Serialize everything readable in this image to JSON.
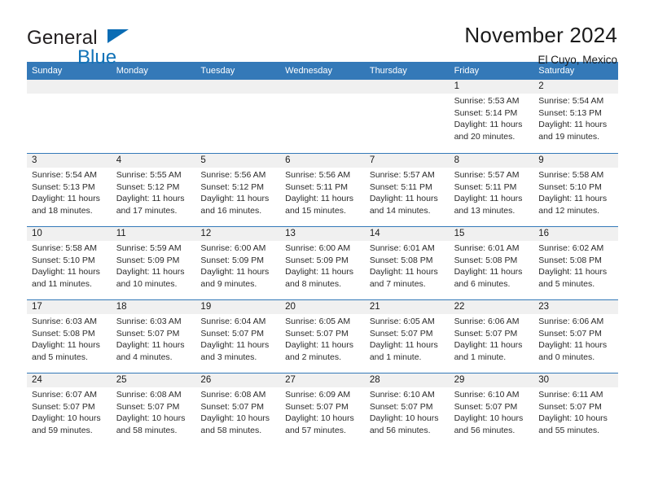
{
  "brand": {
    "name_part1": "General",
    "name_part2": "Blue",
    "logo_icon": "triangle-flag-icon"
  },
  "header": {
    "title": "November 2024",
    "subtitle": "El Cuyo, Mexico"
  },
  "colors": {
    "header_blue": "#3479b8",
    "day_band_gray": "#f0f0f0",
    "brand_blue": "#1273b8",
    "text": "#1a1a1a"
  },
  "weekdays": [
    "Sunday",
    "Monday",
    "Tuesday",
    "Wednesday",
    "Thursday",
    "Friday",
    "Saturday"
  ],
  "weeks": [
    [
      {
        "day": "",
        "empty": true
      },
      {
        "day": "",
        "empty": true
      },
      {
        "day": "",
        "empty": true
      },
      {
        "day": "",
        "empty": true
      },
      {
        "day": "",
        "empty": true
      },
      {
        "day": "1",
        "sunrise": "Sunrise: 5:53 AM",
        "sunset": "Sunset: 5:14 PM",
        "daylight": "Daylight: 11 hours and 20 minutes."
      },
      {
        "day": "2",
        "sunrise": "Sunrise: 5:54 AM",
        "sunset": "Sunset: 5:13 PM",
        "daylight": "Daylight: 11 hours and 19 minutes."
      }
    ],
    [
      {
        "day": "3",
        "sunrise": "Sunrise: 5:54 AM",
        "sunset": "Sunset: 5:13 PM",
        "daylight": "Daylight: 11 hours and 18 minutes."
      },
      {
        "day": "4",
        "sunrise": "Sunrise: 5:55 AM",
        "sunset": "Sunset: 5:12 PM",
        "daylight": "Daylight: 11 hours and 17 minutes."
      },
      {
        "day": "5",
        "sunrise": "Sunrise: 5:56 AM",
        "sunset": "Sunset: 5:12 PM",
        "daylight": "Daylight: 11 hours and 16 minutes."
      },
      {
        "day": "6",
        "sunrise": "Sunrise: 5:56 AM",
        "sunset": "Sunset: 5:11 PM",
        "daylight": "Daylight: 11 hours and 15 minutes."
      },
      {
        "day": "7",
        "sunrise": "Sunrise: 5:57 AM",
        "sunset": "Sunset: 5:11 PM",
        "daylight": "Daylight: 11 hours and 14 minutes."
      },
      {
        "day": "8",
        "sunrise": "Sunrise: 5:57 AM",
        "sunset": "Sunset: 5:11 PM",
        "daylight": "Daylight: 11 hours and 13 minutes."
      },
      {
        "day": "9",
        "sunrise": "Sunrise: 5:58 AM",
        "sunset": "Sunset: 5:10 PM",
        "daylight": "Daylight: 11 hours and 12 minutes."
      }
    ],
    [
      {
        "day": "10",
        "sunrise": "Sunrise: 5:58 AM",
        "sunset": "Sunset: 5:10 PM",
        "daylight": "Daylight: 11 hours and 11 minutes."
      },
      {
        "day": "11",
        "sunrise": "Sunrise: 5:59 AM",
        "sunset": "Sunset: 5:09 PM",
        "daylight": "Daylight: 11 hours and 10 minutes."
      },
      {
        "day": "12",
        "sunrise": "Sunrise: 6:00 AM",
        "sunset": "Sunset: 5:09 PM",
        "daylight": "Daylight: 11 hours and 9 minutes."
      },
      {
        "day": "13",
        "sunrise": "Sunrise: 6:00 AM",
        "sunset": "Sunset: 5:09 PM",
        "daylight": "Daylight: 11 hours and 8 minutes."
      },
      {
        "day": "14",
        "sunrise": "Sunrise: 6:01 AM",
        "sunset": "Sunset: 5:08 PM",
        "daylight": "Daylight: 11 hours and 7 minutes."
      },
      {
        "day": "15",
        "sunrise": "Sunrise: 6:01 AM",
        "sunset": "Sunset: 5:08 PM",
        "daylight": "Daylight: 11 hours and 6 minutes."
      },
      {
        "day": "16",
        "sunrise": "Sunrise: 6:02 AM",
        "sunset": "Sunset: 5:08 PM",
        "daylight": "Daylight: 11 hours and 5 minutes."
      }
    ],
    [
      {
        "day": "17",
        "sunrise": "Sunrise: 6:03 AM",
        "sunset": "Sunset: 5:08 PM",
        "daylight": "Daylight: 11 hours and 5 minutes."
      },
      {
        "day": "18",
        "sunrise": "Sunrise: 6:03 AM",
        "sunset": "Sunset: 5:07 PM",
        "daylight": "Daylight: 11 hours and 4 minutes."
      },
      {
        "day": "19",
        "sunrise": "Sunrise: 6:04 AM",
        "sunset": "Sunset: 5:07 PM",
        "daylight": "Daylight: 11 hours and 3 minutes."
      },
      {
        "day": "20",
        "sunrise": "Sunrise: 6:05 AM",
        "sunset": "Sunset: 5:07 PM",
        "daylight": "Daylight: 11 hours and 2 minutes."
      },
      {
        "day": "21",
        "sunrise": "Sunrise: 6:05 AM",
        "sunset": "Sunset: 5:07 PM",
        "daylight": "Daylight: 11 hours and 1 minute."
      },
      {
        "day": "22",
        "sunrise": "Sunrise: 6:06 AM",
        "sunset": "Sunset: 5:07 PM",
        "daylight": "Daylight: 11 hours and 1 minute."
      },
      {
        "day": "23",
        "sunrise": "Sunrise: 6:06 AM",
        "sunset": "Sunset: 5:07 PM",
        "daylight": "Daylight: 11 hours and 0 minutes."
      }
    ],
    [
      {
        "day": "24",
        "sunrise": "Sunrise: 6:07 AM",
        "sunset": "Sunset: 5:07 PM",
        "daylight": "Daylight: 10 hours and 59 minutes."
      },
      {
        "day": "25",
        "sunrise": "Sunrise: 6:08 AM",
        "sunset": "Sunset: 5:07 PM",
        "daylight": "Daylight: 10 hours and 58 minutes."
      },
      {
        "day": "26",
        "sunrise": "Sunrise: 6:08 AM",
        "sunset": "Sunset: 5:07 PM",
        "daylight": "Daylight: 10 hours and 58 minutes."
      },
      {
        "day": "27",
        "sunrise": "Sunrise: 6:09 AM",
        "sunset": "Sunset: 5:07 PM",
        "daylight": "Daylight: 10 hours and 57 minutes."
      },
      {
        "day": "28",
        "sunrise": "Sunrise: 6:10 AM",
        "sunset": "Sunset: 5:07 PM",
        "daylight": "Daylight: 10 hours and 56 minutes."
      },
      {
        "day": "29",
        "sunrise": "Sunrise: 6:10 AM",
        "sunset": "Sunset: 5:07 PM",
        "daylight": "Daylight: 10 hours and 56 minutes."
      },
      {
        "day": "30",
        "sunrise": "Sunrise: 6:11 AM",
        "sunset": "Sunset: 5:07 PM",
        "daylight": "Daylight: 10 hours and 55 minutes."
      }
    ]
  ]
}
